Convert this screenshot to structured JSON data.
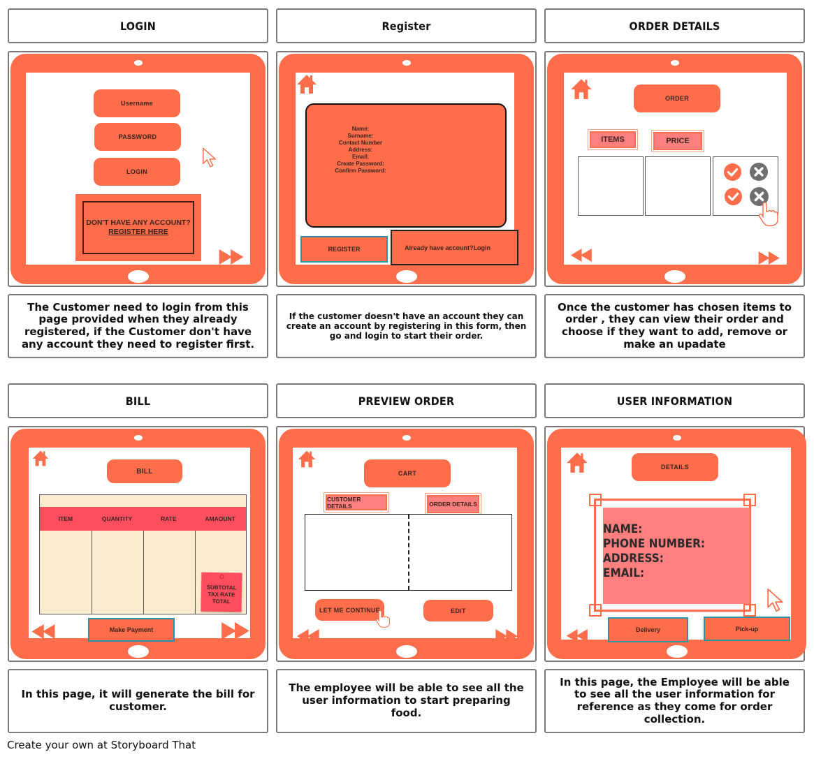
{
  "storyboard": {
    "footer": "Create your own at Storyboard That",
    "colors": {
      "accent": "#ff6d4a",
      "label_pink": "#ff7f7f",
      "bill_header": "#ff4f5e",
      "bill_body": "#fdebcf",
      "teal_border": "#2f93a8",
      "icon_gray": "#6e6e6e"
    },
    "cells": [
      {
        "title": "LOGIN",
        "caption": "The Customer need to login from this page provided when they already registered, if the Customer don't have any account they need to register first.",
        "screen": {
          "fields": [
            "Username",
            "PASSWORD",
            "LOGIN"
          ],
          "register_prompt": "DON'T HAVE ANY ACCOUNT?",
          "register_link": "REGISTER HERE",
          "icons": [
            "cursor-arrow-icon",
            "fast-forward-icon"
          ]
        }
      },
      {
        "title": "Register",
        "caption": "If the customer doesn't have an account they can create an account by registering in this form, then go and login to start their order.",
        "screen": {
          "form_fields": [
            "Name:",
            "Surname:",
            "Contact Number",
            "Address:",
            "Email:",
            "Create Password:",
            "Confirm Password:"
          ],
          "register_button": "REGISTER",
          "login_link": "Already have account?Login",
          "icons": [
            "home-icon"
          ]
        }
      },
      {
        "title": "ORDER DETAILS",
        "caption": "Once the customer has chosen items to order , they can view their order and choose if they want to add, remove or make an upadate",
        "screen": {
          "header": "ORDER",
          "columns": [
            "ITEMS",
            "PRICE"
          ],
          "actions": [
            "check-icon",
            "x-icon",
            "check-icon",
            "x-icon"
          ],
          "icons": [
            "home-icon",
            "rewind-icon",
            "fast-forward-icon",
            "hand-pointer-icon"
          ]
        }
      },
      {
        "title": "BILL",
        "caption": "In this page, it will generate the bill for customer.",
        "screen": {
          "header": "BILL",
          "columns": [
            "ITEM",
            "QUANTITY",
            "RATE",
            "AMAOUNT"
          ],
          "totals_note": [
            "SUBTOTAL",
            "TAX RATE",
            "TOTAL"
          ],
          "pay_button": "Make Payment",
          "icons": [
            "home-icon",
            "rewind-icon",
            "fast-forward-icon"
          ]
        }
      },
      {
        "title": "PREVIEW ORDER",
        "caption": "The employee will be able to see all the user information to start preparing food.",
        "screen": {
          "header": "CART",
          "sections": [
            "CUSTOMER DETAILS",
            "ORDER DETAILS"
          ],
          "continue_button": "LET ME CONTINUE",
          "edit_button": "EDIT",
          "icons": [
            "home-icon",
            "rewind-icon",
            "fast-forward-icon",
            "hand-pointer-icon"
          ]
        }
      },
      {
        "title": "USER INFORMATION",
        "caption": "In this page, the Employee will be able to see all the user information for reference as they come for order collection.",
        "screen": {
          "header": "DETAILS",
          "info_fields": [
            "NAME:",
            "PHONE NUMBER:",
            "ADDRESS:",
            "EMAIL:"
          ],
          "delivery_button": "Delivery",
          "pickup_button": "Pick-up",
          "icons": [
            "home-icon",
            "rewind-icon",
            "cursor-arrow-icon"
          ]
        }
      }
    ]
  }
}
